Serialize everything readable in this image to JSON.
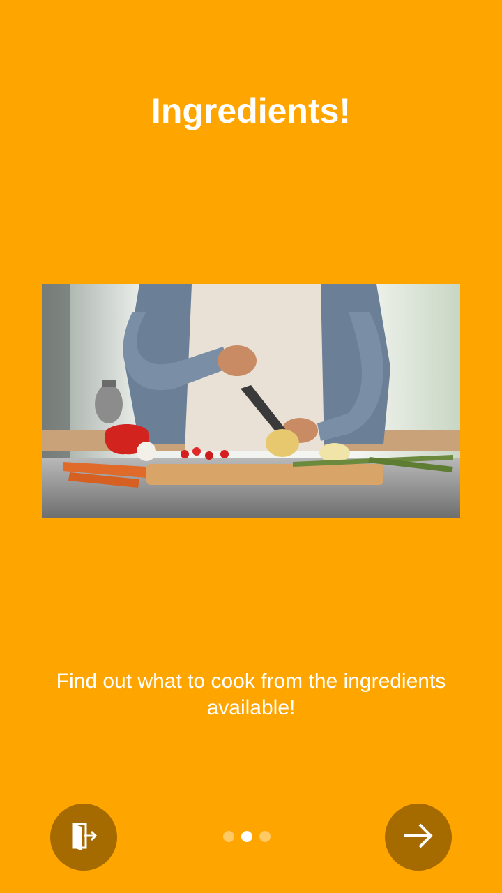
{
  "onboarding": {
    "title": "Ingredients!",
    "description": "Find out what to cook from the ingredients available!",
    "image_alt": "Person chopping vegetables on a cutting board in a kitchen",
    "pagination": {
      "total": 3,
      "current": 2
    },
    "buttons": {
      "skip_icon": "exit-door-icon",
      "next_icon": "arrow-right-icon"
    }
  },
  "colors": {
    "background": "#FFA500",
    "button": "#A56A00",
    "text": "#FFFFFF"
  }
}
